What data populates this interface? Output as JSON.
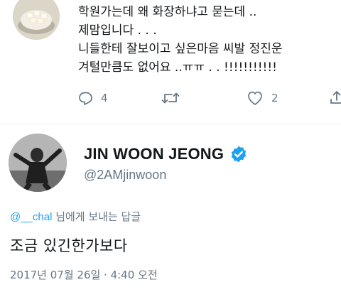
{
  "reply_tweet": {
    "lines": [
      "학원가는데 왜 화장하냐고 묻는데 ..",
      "제맘입니다 . . .",
      "니들한테 잘보이고 싶은마음 씨발 정진운",
      "겨털만큼도 없어요 ..ㅠㅠ . . !!!!!!!!!!!"
    ],
    "actions": {
      "reply_icon": "reply-icon",
      "reply_count": "4",
      "retweet_icon": "retweet-icon",
      "like_icon": "heart-icon",
      "like_count": "2",
      "share_icon": "share-icon"
    }
  },
  "main_tweet": {
    "display_name": "JIN WOON JEONG",
    "verified_icon": "verified-badge-icon",
    "handle": "@2AMjinwoon",
    "reply_context": {
      "mention": "@__chal",
      "suffix": " 님에게 보내는 답글"
    },
    "text": "조금 있긴한가보다",
    "timestamp": "2017년 07월 26일 · 4:40 오전"
  },
  "colors": {
    "accent": "#1da1f2",
    "secondary_text": "#657786",
    "primary_text": "#14171a",
    "divider": "#e6ecf0"
  }
}
